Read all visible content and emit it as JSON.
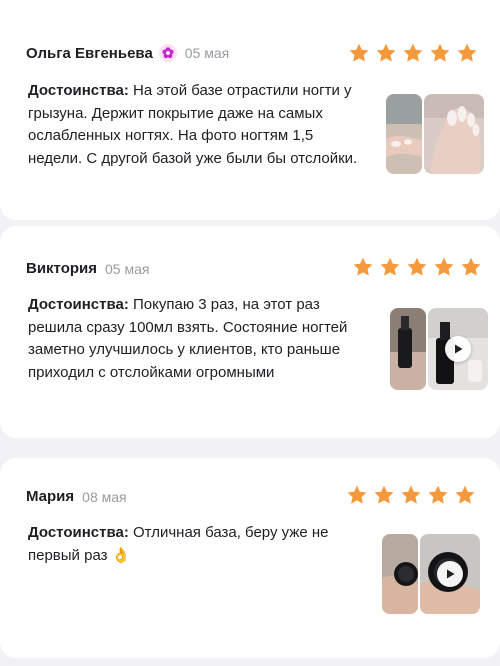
{
  "reviews": [
    {
      "author": "Ольга Евгеньева",
      "date": "05 мая",
      "badge_icon": "flower-badge-icon",
      "rating": 5,
      "label": "Достоинства:",
      "text": "На этой базе отрастили ногти у грызуна. Держит покрытие даже на самых ослабленных ногтях. На фото ногтям 1,5 недели. С другой базой уже были бы отслойки.",
      "media": [
        "photo",
        "photo"
      ]
    },
    {
      "author": "Виктория",
      "date": "05 мая",
      "rating": 5,
      "label": "Достоинства:",
      "text": "Покупаю 3 раз, на этот раз решила сразу 100мл взять. Состояние ногтей заметно улучшилось у клиентов, кто раньше приходил с отслойками огромными",
      "media": [
        "photo",
        "video"
      ]
    },
    {
      "author": "Мария",
      "date": "08 мая",
      "rating": 5,
      "label": "Достоинства:",
      "text": "Отличная база, беру уже не первый раз",
      "emoji": "👌",
      "media": [
        "photo",
        "video"
      ]
    }
  ],
  "colors": {
    "star": "#f59a3c",
    "badge_icon": "#c52ad1",
    "date": "#9a9aa2",
    "background": "#f2f2f4"
  }
}
